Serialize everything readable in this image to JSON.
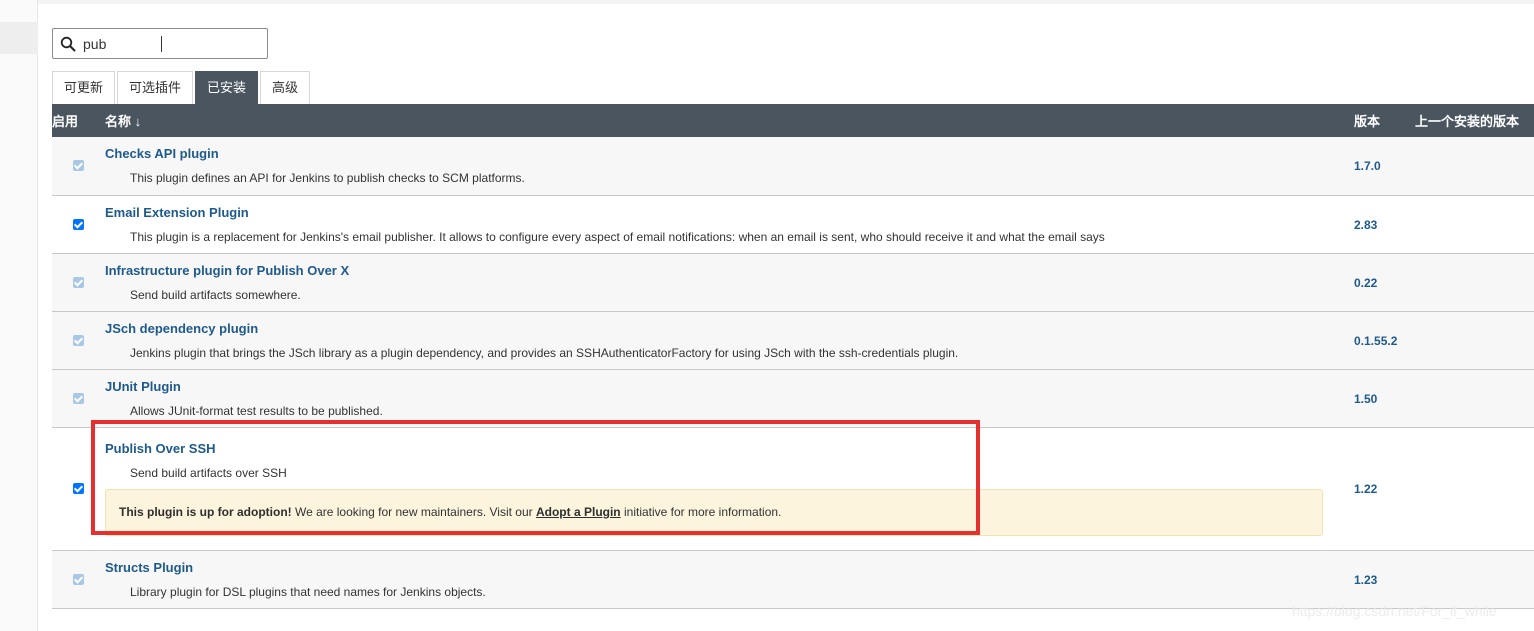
{
  "search": {
    "value": "pub",
    "placeholder": ""
  },
  "tabs": [
    {
      "label": "可更新",
      "active": false
    },
    {
      "label": "可选插件",
      "active": false
    },
    {
      "label": "已安装",
      "active": true
    },
    {
      "label": "高级",
      "active": false
    }
  ],
  "table": {
    "headers": {
      "enabled": "启用",
      "name": "名称 ↓",
      "version": "版本",
      "previous": "上一个安装的版本"
    },
    "rows": [
      {
        "name": "Checks API plugin",
        "description": "This plugin defines an API for Jenkins to publish checks to SCM platforms.",
        "version": "1.7.0",
        "checked": true,
        "disabled": true
      },
      {
        "name": "Email Extension Plugin",
        "description": "This plugin is a replacement for Jenkins's email publisher. It allows to configure every aspect of email notifications: when an email is sent, who should receive it and what the email says",
        "version": "2.83",
        "checked": true,
        "disabled": false
      },
      {
        "name": "Infrastructure plugin for Publish Over X",
        "description": "Send build artifacts somewhere.",
        "version": "0.22",
        "checked": true,
        "disabled": true
      },
      {
        "name": "JSch dependency plugin",
        "description": "Jenkins plugin that brings the JSch library as a plugin dependency, and provides an SSHAuthenticatorFactory for using JSch with the ssh-credentials plugin.",
        "version": "0.1.55.2",
        "checked": true,
        "disabled": true
      },
      {
        "name": "JUnit Plugin",
        "description": "Allows JUnit-format test results to be published.",
        "version": "1.50",
        "checked": true,
        "disabled": true
      },
      {
        "name": "Publish Over SSH",
        "description": "Send build artifacts over SSH",
        "version": "1.22",
        "checked": true,
        "disabled": false,
        "adoption": {
          "bold": "This plugin is up for adoption!",
          "text": " We are looking for new maintainers. Visit our ",
          "link": "Adopt a Plugin",
          "after": " initiative for more information."
        }
      },
      {
        "name": "Structs Plugin",
        "description": "Library plugin for DSL plugins that need names for Jenkins objects.",
        "version": "1.23",
        "checked": true,
        "disabled": true
      }
    ]
  },
  "watermark": "https://blog.csdn.net/For_if_while",
  "colors": {
    "header_bg": "#4a5560",
    "link": "#1e5a8c",
    "highlight": "#e4312f",
    "adoption_bg": "#fcf4dc"
  },
  "icons": {
    "search": "search-icon",
    "checkbox": "checkbox-icon"
  }
}
